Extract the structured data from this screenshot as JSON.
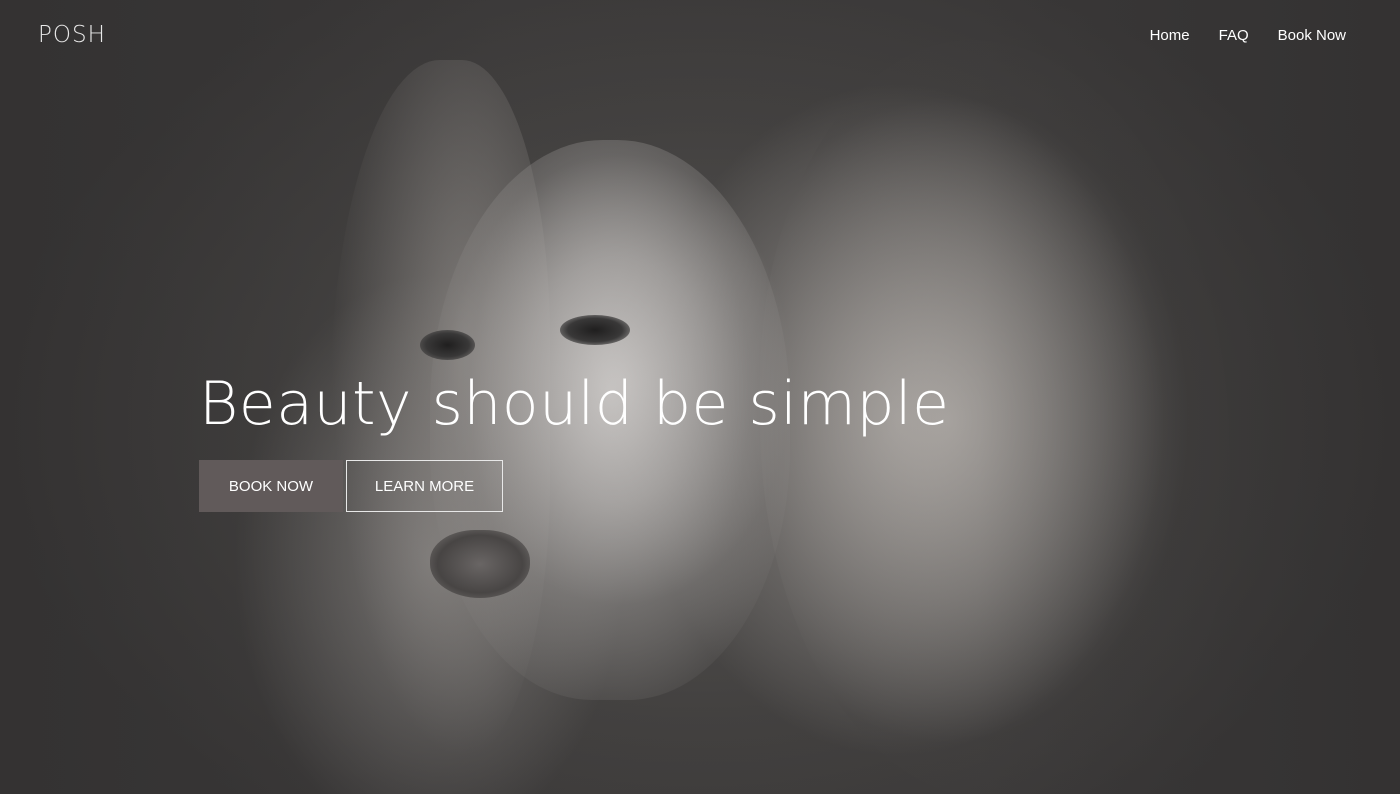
{
  "brand": {
    "logo_text": "POSH"
  },
  "nav": {
    "items": [
      {
        "label": "Home"
      },
      {
        "label": "FAQ"
      },
      {
        "label": "Book Now"
      }
    ]
  },
  "hero": {
    "headline": "Beauty should be simple",
    "primary_button": "BOOK NOW",
    "secondary_button": "LEARN MORE",
    "image": "hero-portrait-photo"
  },
  "colors": {
    "background": "#3a3838",
    "primary_button_bg": "#615a5a",
    "text": "#ffffff"
  }
}
